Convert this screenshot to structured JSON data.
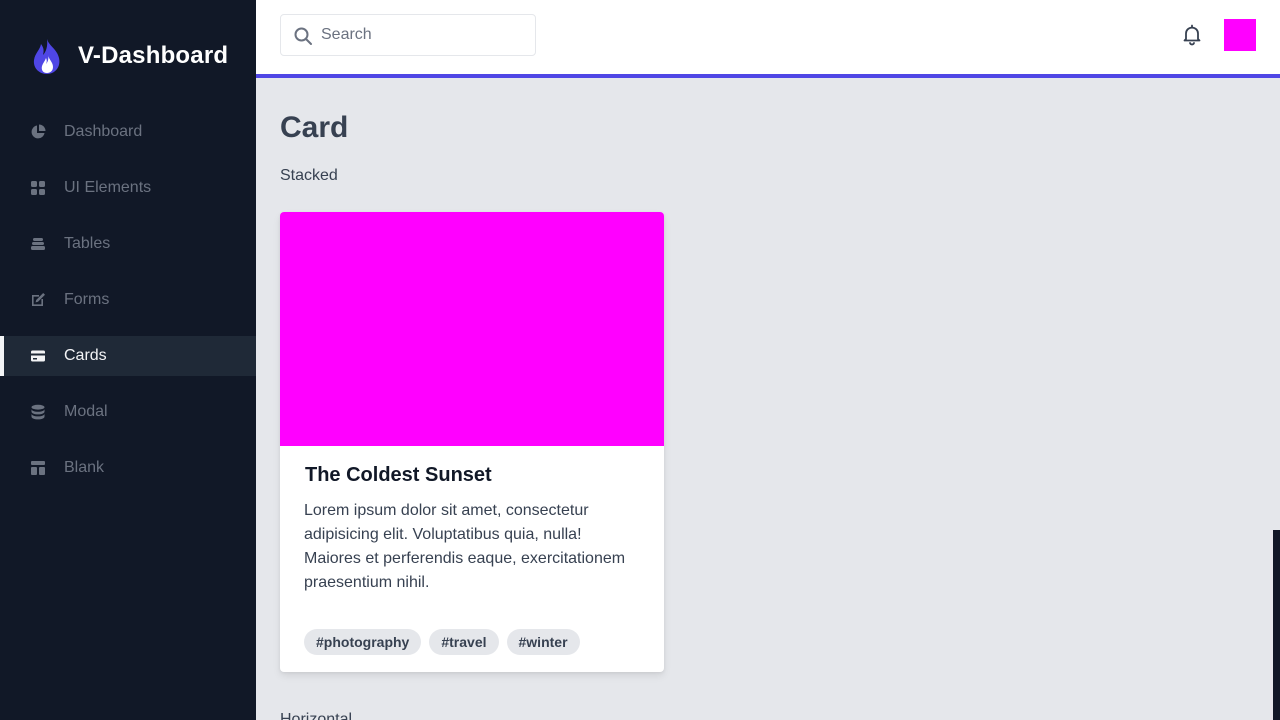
{
  "brand": {
    "name": "V-Dashboard",
    "accent": "#4f46e5"
  },
  "sidebar": {
    "items": [
      {
        "label": "Dashboard",
        "icon": "pie-chart-icon",
        "active": false
      },
      {
        "label": "UI Elements",
        "icon": "grid-icon",
        "active": false
      },
      {
        "label": "Tables",
        "icon": "stack-icon",
        "active": false
      },
      {
        "label": "Forms",
        "icon": "edit-icon",
        "active": false
      },
      {
        "label": "Cards",
        "icon": "credit-card-icon",
        "active": true
      },
      {
        "label": "Modal",
        "icon": "database-icon",
        "active": false
      },
      {
        "label": "Blank",
        "icon": "layout-icon",
        "active": false
      }
    ]
  },
  "header": {
    "search": {
      "placeholder": "Search",
      "value": ""
    },
    "notifications_icon": "bell-icon",
    "avatar_color": "#ff00ff"
  },
  "page": {
    "title": "Card",
    "sections": [
      {
        "label": "Stacked"
      },
      {
        "label": "Horizontal"
      }
    ]
  },
  "card": {
    "image_color": "#ff00ff",
    "title": "The Coldest Sunset",
    "text": "Lorem ipsum dolor sit amet, consectetur adipisicing elit. Voluptatibus quia, nulla! Maiores et perferendis eaque, exercitationem praesentium nihil.",
    "tags": [
      "#photography",
      "#travel",
      "#winter"
    ]
  }
}
